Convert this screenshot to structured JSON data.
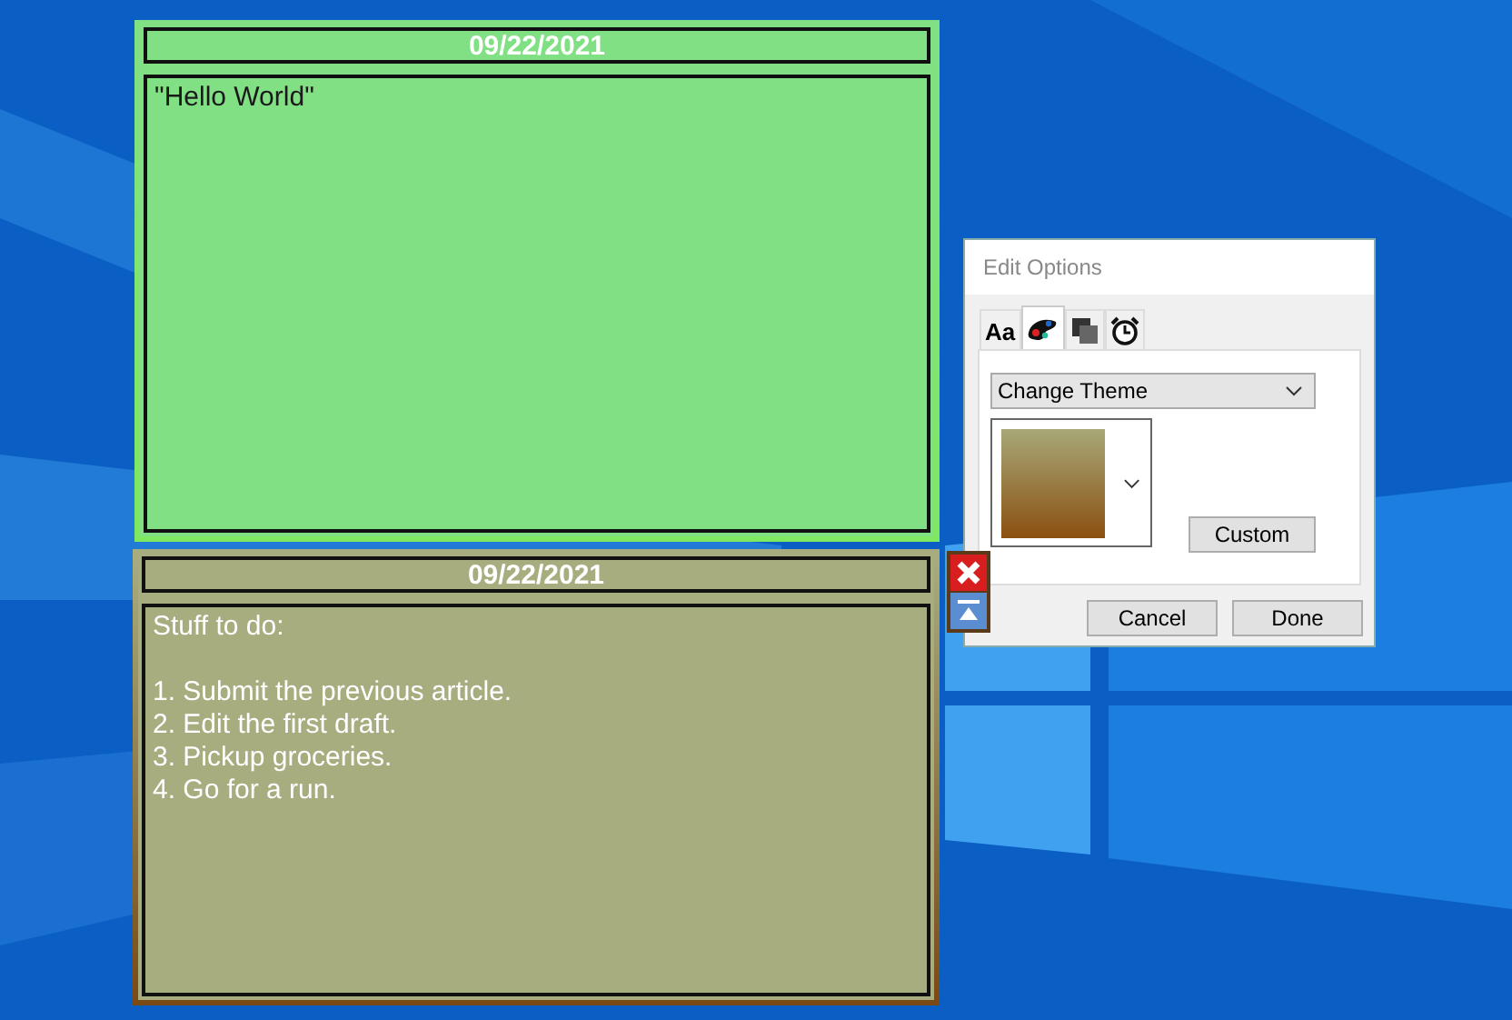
{
  "notes": [
    {
      "date": "09/22/2021",
      "color": "#82e084",
      "paragraphs": [
        [
          "\"Hello World\""
        ]
      ],
      "controls": false
    },
    {
      "date": "09/22/2021",
      "color": "#a8ad80",
      "paragraphs": [
        [
          "Stuff to do:"
        ],
        [
          "1. Submit the previous article.",
          "2. Edit the first draft.",
          "3. Pickup groceries.",
          "4. Go for a run."
        ]
      ],
      "controls": true
    }
  ],
  "dialog": {
    "title": "Edit Options",
    "tabs": [
      {
        "kind": "font",
        "label": "Aa",
        "selected": false
      },
      {
        "kind": "palette",
        "selected": true
      },
      {
        "kind": "layers",
        "selected": false
      },
      {
        "kind": "clock",
        "selected": false
      }
    ],
    "theme_select": {
      "value": "Change Theme"
    },
    "custom_button": "Custom",
    "buttons": [
      "Cancel",
      "Done"
    ]
  }
}
